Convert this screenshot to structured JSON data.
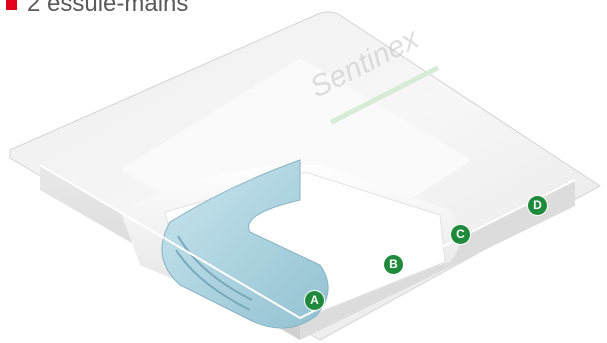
{
  "caption": {
    "text": "2 essuie-mains"
  },
  "brand_watermark": "Sentinex",
  "labels": {
    "a": "A",
    "b": "B",
    "c": "C",
    "d": "D"
  },
  "colors": {
    "bullet": "#e3001b",
    "marker": "#1f8a3b",
    "towel_blue": "#b7dde8",
    "tray_white": "#f4f4f4"
  }
}
